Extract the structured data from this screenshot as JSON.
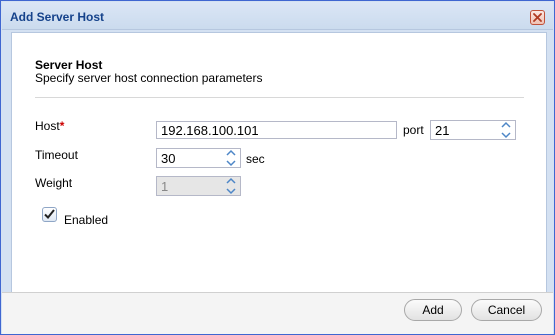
{
  "window": {
    "title": "Add Server Host"
  },
  "section": {
    "title": "Server Host",
    "subtitle": "Specify server host connection parameters"
  },
  "form": {
    "host": {
      "label": "Host",
      "required_mark": "*",
      "value": "192.168.100.101"
    },
    "port": {
      "label": "port",
      "value": "21"
    },
    "timeout": {
      "label": "Timeout",
      "value": "30",
      "unit": "sec"
    },
    "weight": {
      "label": "Weight",
      "value": "1",
      "disabled": true
    },
    "enabled": {
      "label": "Enabled",
      "checked": true
    }
  },
  "buttons": {
    "add": "Add",
    "cancel": "Cancel"
  },
  "colors": {
    "border": "#3f66d1",
    "title_text": "#15428b",
    "required": "#cc0000"
  }
}
